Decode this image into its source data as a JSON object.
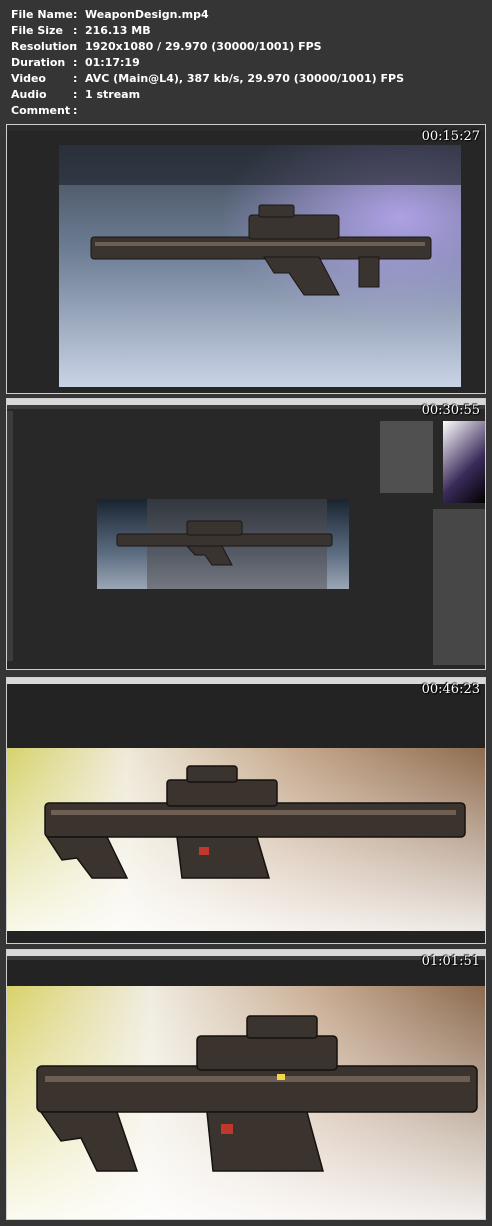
{
  "file_info": [
    {
      "label": "File Name",
      "value": "WeaponDesign.mp4"
    },
    {
      "label": "File Size",
      "value": "216.13 MB"
    },
    {
      "label": "Resolution",
      "value": "1920x1080 / 29.970 (30000/1001) FPS"
    },
    {
      "label": "Duration",
      "value": "01:17:19"
    },
    {
      "label": "Video",
      "value": "AVC (Main@L4), 387 kb/s, 29.970 (30000/1001) FPS"
    },
    {
      "label": "Audio",
      "value": "1 stream"
    },
    {
      "label": "Comment",
      "value": ""
    }
  ],
  "frames": [
    {
      "timestamp": "00:15:27"
    },
    {
      "timestamp": "00:30:55"
    },
    {
      "timestamp": "00:46:23"
    },
    {
      "timestamp": "01:01:51"
    }
  ],
  "colors": {
    "background": "#353535",
    "frame_border": "#cfcfcf",
    "text": "#ffffff"
  }
}
